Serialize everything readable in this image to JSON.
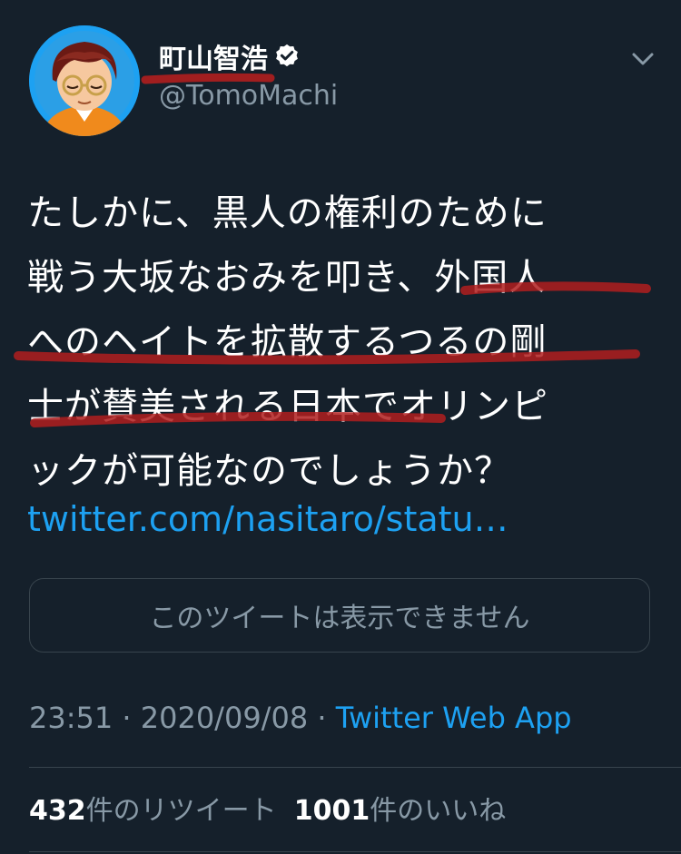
{
  "user": {
    "display_name": "町山智浩",
    "handle": "@TomoMachi",
    "verified": true
  },
  "tweet": {
    "lines": [
      "たしかに、黒人の権利のために",
      "戦う大坂なおみを叩き、外国人",
      "へのヘイトを拡散するつるの剛",
      "士が賛美される日本でオリンピ",
      "ックが可能なのでしょうか？"
    ],
    "link": "twitter.com/nasitaro/statu…",
    "unavailable_notice": "このツイートは表示できません"
  },
  "meta": {
    "time": "23:51",
    "separator": " · ",
    "date": "2020/09/08",
    "app": "Twitter Web App"
  },
  "stats": {
    "retweets_count": "432",
    "retweets_label": "件のリツイート",
    "likes_count": "1001",
    "likes_label": "件のいいね"
  },
  "icons": {
    "verified": "verified-badge-icon",
    "menu": "chevron-down-icon"
  },
  "colors": {
    "background": "#15202b",
    "text": "#ffffff",
    "secondary": "#8899a6",
    "accent": "#1da1f2",
    "border": "#38444d",
    "annotation": "#b01e1e"
  }
}
